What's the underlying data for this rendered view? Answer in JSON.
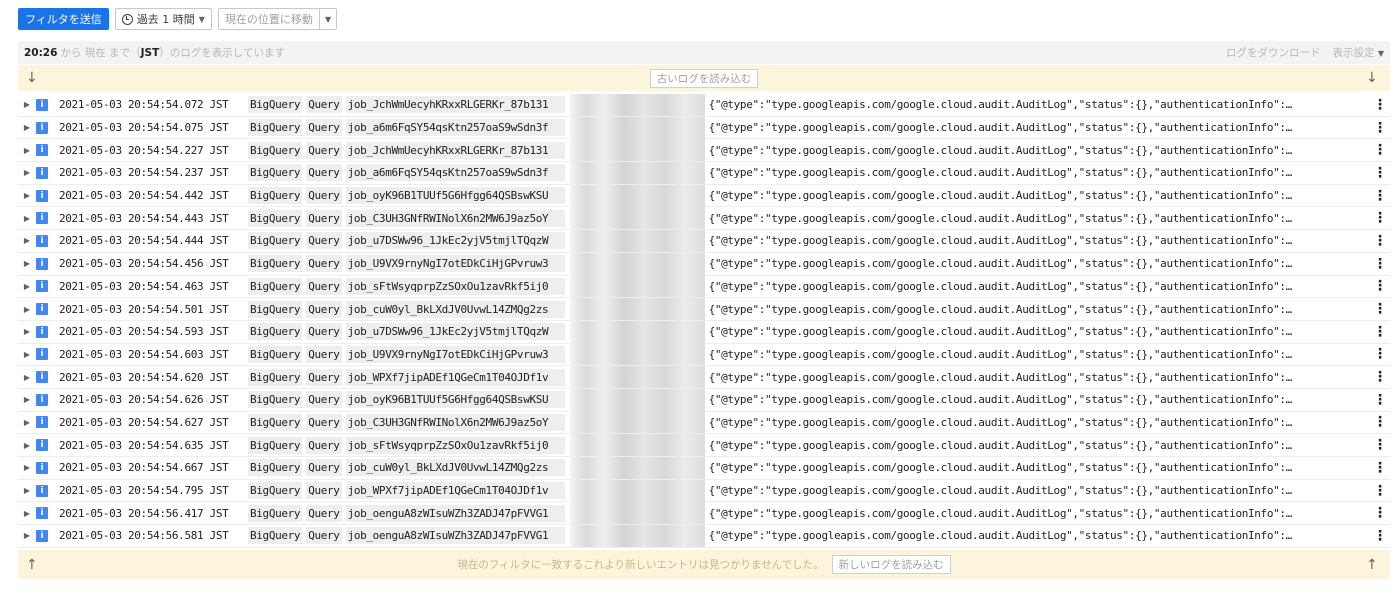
{
  "toolbar": {
    "submit_filter": "フィルタを送信",
    "time_range": "過去 1 時間",
    "jump_to_now": "現在の位置に移動"
  },
  "infobar": {
    "time": "20:26",
    "message_pre": "から 現在 まで（",
    "timezone": "JST",
    "message_post": "）のログを表示しています",
    "download": "ログをダウンロード",
    "display_settings": "表示設定"
  },
  "load_older": "古いログを読み込む",
  "no_newer_message": "現在のフィルタに一致するこれより新しいエントリは見つかりませんでした。",
  "load_newer": "新しいログを読み込む",
  "payload_text": "{\"@type\":\"type.googleapis.com/google.cloud.audit.AuditLog\",\"status\":{},\"authenticationInfo\":…",
  "logs": [
    {
      "severity": "i",
      "timestamp": "2021-05-03 20:54:54.072 JST",
      "service": "BigQuery",
      "method": "Query",
      "job": "job_JchWmUecyhKRxxRLGERKr_87b131"
    },
    {
      "severity": "i",
      "timestamp": "2021-05-03 20:54:54.075 JST",
      "service": "BigQuery",
      "method": "Query",
      "job": "job_a6m6FqSY54qsKtn257oaS9wSdn3f"
    },
    {
      "severity": "i",
      "timestamp": "2021-05-03 20:54:54.227 JST",
      "service": "BigQuery",
      "method": "Query",
      "job": "job_JchWmUecyhKRxxRLGERKr_87b131"
    },
    {
      "severity": "i",
      "timestamp": "2021-05-03 20:54:54.237 JST",
      "service": "BigQuery",
      "method": "Query",
      "job": "job_a6m6FqSY54qsKtn257oaS9wSdn3f"
    },
    {
      "severity": "i",
      "timestamp": "2021-05-03 20:54:54.442 JST",
      "service": "BigQuery",
      "method": "Query",
      "job": "job_oyK96B1TUUf5G6Hfgg64QSBswKSU"
    },
    {
      "severity": "i",
      "timestamp": "2021-05-03 20:54:54.443 JST",
      "service": "BigQuery",
      "method": "Query",
      "job": "job_C3UH3GNfRWINolX6n2MW6J9az5oY"
    },
    {
      "severity": "i",
      "timestamp": "2021-05-03 20:54:54.444 JST",
      "service": "BigQuery",
      "method": "Query",
      "job": "job_u7DSWw96_1JkEc2yjV5tmjlTQqzW"
    },
    {
      "severity": "i",
      "timestamp": "2021-05-03 20:54:54.456 JST",
      "service": "BigQuery",
      "method": "Query",
      "job": "job_U9VX9rnyNgI7otEDkCiHjGPvruw3"
    },
    {
      "severity": "i",
      "timestamp": "2021-05-03 20:54:54.463 JST",
      "service": "BigQuery",
      "method": "Query",
      "job": "job_sFtWsyqprpZzSOxOu1zavRkf5ij0"
    },
    {
      "severity": "i",
      "timestamp": "2021-05-03 20:54:54.501 JST",
      "service": "BigQuery",
      "method": "Query",
      "job": "job_cuW0yl_BkLXdJV0UvwL14ZMQg2zs"
    },
    {
      "severity": "i",
      "timestamp": "2021-05-03 20:54:54.593 JST",
      "service": "BigQuery",
      "method": "Query",
      "job": "job_u7DSWw96_1JkEc2yjV5tmjlTQqzW"
    },
    {
      "severity": "i",
      "timestamp": "2021-05-03 20:54:54.603 JST",
      "service": "BigQuery",
      "method": "Query",
      "job": "job_U9VX9rnyNgI7otEDkCiHjGPvruw3"
    },
    {
      "severity": "i",
      "timestamp": "2021-05-03 20:54:54.620 JST",
      "service": "BigQuery",
      "method": "Query",
      "job": "job_WPXf7jipADEf1QGeCm1T04OJDf1v"
    },
    {
      "severity": "i",
      "timestamp": "2021-05-03 20:54:54.626 JST",
      "service": "BigQuery",
      "method": "Query",
      "job": "job_oyK96B1TUUf5G6Hfgg64QSBswKSU"
    },
    {
      "severity": "i",
      "timestamp": "2021-05-03 20:54:54.627 JST",
      "service": "BigQuery",
      "method": "Query",
      "job": "job_C3UH3GNfRWINolX6n2MW6J9az5oY"
    },
    {
      "severity": "i",
      "timestamp": "2021-05-03 20:54:54.635 JST",
      "service": "BigQuery",
      "method": "Query",
      "job": "job_sFtWsyqprpZzSOxOu1zavRkf5ij0"
    },
    {
      "severity": "i",
      "timestamp": "2021-05-03 20:54:54.667 JST",
      "service": "BigQuery",
      "method": "Query",
      "job": "job_cuW0yl_BkLXdJV0UvwL14ZMQg2zs"
    },
    {
      "severity": "i",
      "timestamp": "2021-05-03 20:54:54.795 JST",
      "service": "BigQuery",
      "method": "Query",
      "job": "job_WPXf7jipADEf1QGeCm1T04OJDf1v"
    },
    {
      "severity": "i",
      "timestamp": "2021-05-03 20:54:56.417 JST",
      "service": "BigQuery",
      "method": "Query",
      "job": "job_oenguA8zWIsuWZh3ZADJ47pFVVG1"
    },
    {
      "severity": "i",
      "timestamp": "2021-05-03 20:54:56.581 JST",
      "service": "BigQuery",
      "method": "Query",
      "job": "job_oenguA8zWIsuWZh3ZADJ47pFVVG1"
    }
  ]
}
